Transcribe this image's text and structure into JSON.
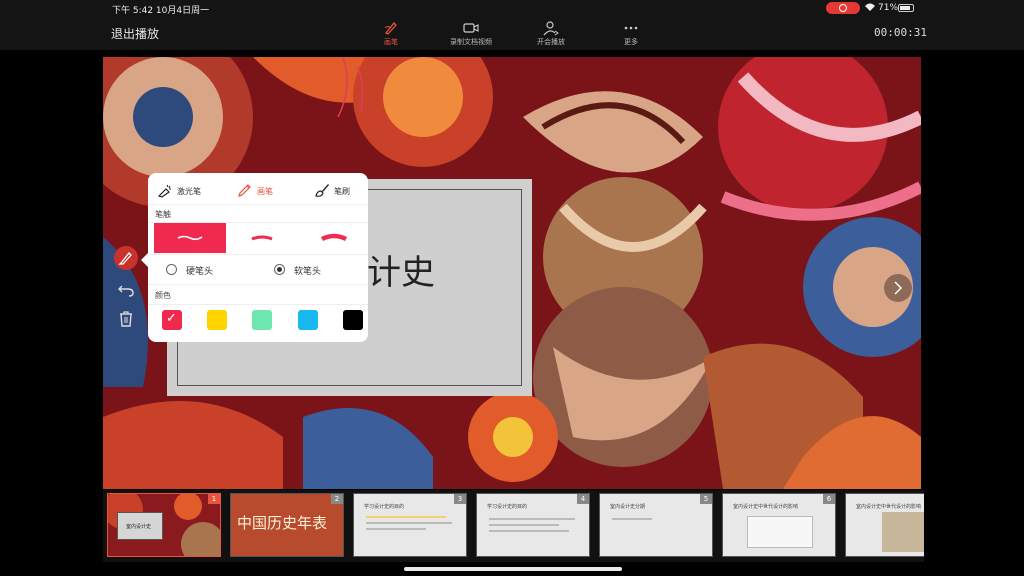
{
  "status_bar": {
    "time": "下午 5:42   10月4日周一",
    "battery": "71%"
  },
  "toolbar": {
    "exit_label": "退出播放",
    "tools": [
      {
        "label": "画笔",
        "icon": "pen-brush-icon",
        "active": true
      },
      {
        "label": "录制文档视频",
        "icon": "video-camera-icon",
        "active": false
      },
      {
        "label": "开会播放",
        "icon": "person-share-icon",
        "active": false
      },
      {
        "label": "更多",
        "icon": "more-dots-icon",
        "active": false
      }
    ],
    "timer": "00:00:31"
  },
  "slide": {
    "title_partial": "计史"
  },
  "pen_popup": {
    "pen_types": [
      {
        "label": "激光笔",
        "icon": "laser-pen-icon",
        "active": false
      },
      {
        "label": "画笔",
        "icon": "pencil-icon",
        "active": true
      },
      {
        "label": "笔刷",
        "icon": "brush-icon",
        "active": false
      }
    ],
    "stroke_label": "笔触",
    "tip_options": [
      {
        "label": "硬笔头",
        "selected": false
      },
      {
        "label": "软笔头",
        "selected": true
      }
    ],
    "color_label": "颜色",
    "colors": [
      "#f0294f",
      "#ffd500",
      "#6ee6b0",
      "#19b8f0",
      "#000000"
    ],
    "selected_color_index": 0
  },
  "filmstrip": {
    "slides": [
      {
        "num": "1",
        "title": "室内设计史",
        "style": "cover"
      },
      {
        "num": "2",
        "title": "中国历史年表",
        "style": "history"
      },
      {
        "num": "3",
        "title": "学习设计史的目的",
        "style": "text"
      },
      {
        "num": "4",
        "title": "学习设计史的目的",
        "style": "text"
      },
      {
        "num": "5",
        "title": "室内设计史分期",
        "style": "text"
      },
      {
        "num": "6",
        "title": "室内设计史中世代设计的影响",
        "style": "box"
      },
      {
        "num": "7",
        "title": "室内设计史中世代设计的影响",
        "style": "image"
      }
    ]
  }
}
